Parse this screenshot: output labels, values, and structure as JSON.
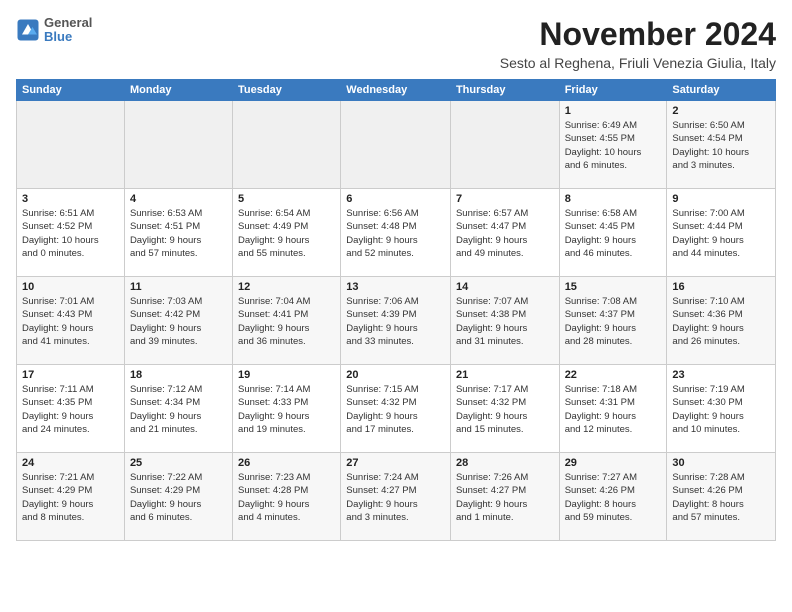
{
  "header": {
    "logo": {
      "line1": "General",
      "line2": "Blue"
    },
    "title": "November 2024",
    "location": "Sesto al Reghena, Friuli Venezia Giulia, Italy"
  },
  "calendar": {
    "days_of_week": [
      "Sunday",
      "Monday",
      "Tuesday",
      "Wednesday",
      "Thursday",
      "Friday",
      "Saturday"
    ],
    "weeks": [
      [
        {
          "day": "",
          "info": ""
        },
        {
          "day": "",
          "info": ""
        },
        {
          "day": "",
          "info": ""
        },
        {
          "day": "",
          "info": ""
        },
        {
          "day": "",
          "info": ""
        },
        {
          "day": "1",
          "info": "Sunrise: 6:49 AM\nSunset: 4:55 PM\nDaylight: 10 hours\nand 6 minutes."
        },
        {
          "day": "2",
          "info": "Sunrise: 6:50 AM\nSunset: 4:54 PM\nDaylight: 10 hours\nand 3 minutes."
        }
      ],
      [
        {
          "day": "3",
          "info": "Sunrise: 6:51 AM\nSunset: 4:52 PM\nDaylight: 10 hours\nand 0 minutes."
        },
        {
          "day": "4",
          "info": "Sunrise: 6:53 AM\nSunset: 4:51 PM\nDaylight: 9 hours\nand 57 minutes."
        },
        {
          "day": "5",
          "info": "Sunrise: 6:54 AM\nSunset: 4:49 PM\nDaylight: 9 hours\nand 55 minutes."
        },
        {
          "day": "6",
          "info": "Sunrise: 6:56 AM\nSunset: 4:48 PM\nDaylight: 9 hours\nand 52 minutes."
        },
        {
          "day": "7",
          "info": "Sunrise: 6:57 AM\nSunset: 4:47 PM\nDaylight: 9 hours\nand 49 minutes."
        },
        {
          "day": "8",
          "info": "Sunrise: 6:58 AM\nSunset: 4:45 PM\nDaylight: 9 hours\nand 46 minutes."
        },
        {
          "day": "9",
          "info": "Sunrise: 7:00 AM\nSunset: 4:44 PM\nDaylight: 9 hours\nand 44 minutes."
        }
      ],
      [
        {
          "day": "10",
          "info": "Sunrise: 7:01 AM\nSunset: 4:43 PM\nDaylight: 9 hours\nand 41 minutes."
        },
        {
          "day": "11",
          "info": "Sunrise: 7:03 AM\nSunset: 4:42 PM\nDaylight: 9 hours\nand 39 minutes."
        },
        {
          "day": "12",
          "info": "Sunrise: 7:04 AM\nSunset: 4:41 PM\nDaylight: 9 hours\nand 36 minutes."
        },
        {
          "day": "13",
          "info": "Sunrise: 7:06 AM\nSunset: 4:39 PM\nDaylight: 9 hours\nand 33 minutes."
        },
        {
          "day": "14",
          "info": "Sunrise: 7:07 AM\nSunset: 4:38 PM\nDaylight: 9 hours\nand 31 minutes."
        },
        {
          "day": "15",
          "info": "Sunrise: 7:08 AM\nSunset: 4:37 PM\nDaylight: 9 hours\nand 28 minutes."
        },
        {
          "day": "16",
          "info": "Sunrise: 7:10 AM\nSunset: 4:36 PM\nDaylight: 9 hours\nand 26 minutes."
        }
      ],
      [
        {
          "day": "17",
          "info": "Sunrise: 7:11 AM\nSunset: 4:35 PM\nDaylight: 9 hours\nand 24 minutes."
        },
        {
          "day": "18",
          "info": "Sunrise: 7:12 AM\nSunset: 4:34 PM\nDaylight: 9 hours\nand 21 minutes."
        },
        {
          "day": "19",
          "info": "Sunrise: 7:14 AM\nSunset: 4:33 PM\nDaylight: 9 hours\nand 19 minutes."
        },
        {
          "day": "20",
          "info": "Sunrise: 7:15 AM\nSunset: 4:32 PM\nDaylight: 9 hours\nand 17 minutes."
        },
        {
          "day": "21",
          "info": "Sunrise: 7:17 AM\nSunset: 4:32 PM\nDaylight: 9 hours\nand 15 minutes."
        },
        {
          "day": "22",
          "info": "Sunrise: 7:18 AM\nSunset: 4:31 PM\nDaylight: 9 hours\nand 12 minutes."
        },
        {
          "day": "23",
          "info": "Sunrise: 7:19 AM\nSunset: 4:30 PM\nDaylight: 9 hours\nand 10 minutes."
        }
      ],
      [
        {
          "day": "24",
          "info": "Sunrise: 7:21 AM\nSunset: 4:29 PM\nDaylight: 9 hours\nand 8 minutes."
        },
        {
          "day": "25",
          "info": "Sunrise: 7:22 AM\nSunset: 4:29 PM\nDaylight: 9 hours\nand 6 minutes."
        },
        {
          "day": "26",
          "info": "Sunrise: 7:23 AM\nSunset: 4:28 PM\nDaylight: 9 hours\nand 4 minutes."
        },
        {
          "day": "27",
          "info": "Sunrise: 7:24 AM\nSunset: 4:27 PM\nDaylight: 9 hours\nand 3 minutes."
        },
        {
          "day": "28",
          "info": "Sunrise: 7:26 AM\nSunset: 4:27 PM\nDaylight: 9 hours\nand 1 minute."
        },
        {
          "day": "29",
          "info": "Sunrise: 7:27 AM\nSunset: 4:26 PM\nDaylight: 8 hours\nand 59 minutes."
        },
        {
          "day": "30",
          "info": "Sunrise: 7:28 AM\nSunset: 4:26 PM\nDaylight: 8 hours\nand 57 minutes."
        }
      ]
    ]
  }
}
